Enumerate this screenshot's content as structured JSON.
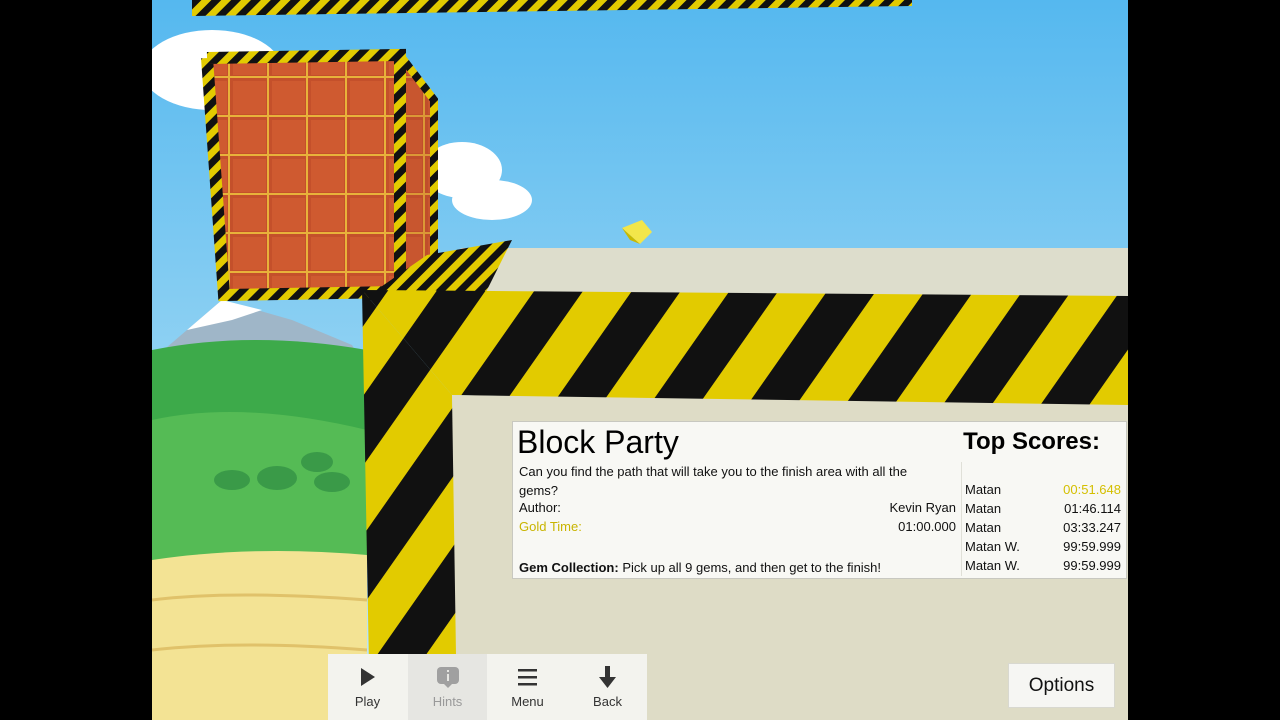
{
  "level": {
    "title": "Block Party",
    "description": "Can you find the path that will take you to the finish area with all the gems?",
    "author_label": "Author:",
    "author": "Kevin Ryan",
    "gold_label": "Gold Time:",
    "gold_time": "01:00.000",
    "gem_label": "Gem Collection:",
    "gem_text": "Pick up all 9 gems, and then get to the finish!"
  },
  "scores": {
    "title": "Top Scores:",
    "entries": [
      {
        "name": "Matan",
        "time": "00:51.648"
      },
      {
        "name": "Matan",
        "time": "01:46.114"
      },
      {
        "name": "Matan",
        "time": "03:33.247"
      },
      {
        "name": "Matan W.",
        "time": "99:59.999"
      },
      {
        "name": "Matan W.",
        "time": "99:59.999"
      }
    ]
  },
  "toolbar": {
    "play": {
      "label": "Play",
      "icon": "play-icon"
    },
    "hints": {
      "label": "Hints",
      "icon": "info-icon"
    },
    "menu": {
      "label": "Menu",
      "icon": "menu-icon"
    },
    "back": {
      "label": "Back",
      "icon": "back-arrow-icon"
    }
  },
  "options_label": "Options",
  "colors": {
    "gold": "#d4bf00",
    "hazard_yellow": "#e5cd00",
    "brick": "#c8502a",
    "sky": "#8fd1f2"
  }
}
